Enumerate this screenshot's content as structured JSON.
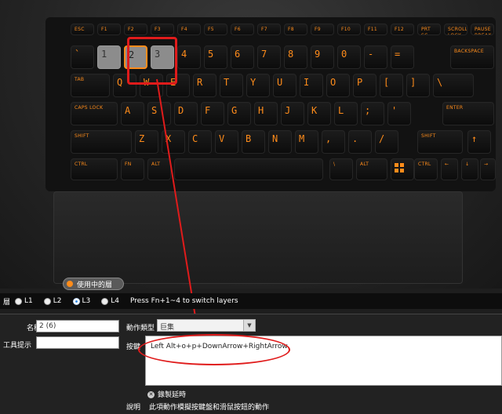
{
  "keyboard": {
    "row_fn": [
      "ESC",
      "F1",
      "F2",
      "F3",
      "F4",
      "F5",
      "F6",
      "F7",
      "F8",
      "F9",
      "F10",
      "F11",
      "F12",
      "PRT SC",
      "SCROLL LOCK",
      "PAUSE BREAK"
    ],
    "row_num": [
      "`",
      "1",
      "2",
      "3",
      "4",
      "5",
      "6",
      "7",
      "8",
      "9",
      "0",
      "-",
      "=",
      "BACKSPACE"
    ],
    "row_tab": [
      "TAB",
      "Q",
      "W",
      "E",
      "R",
      "T",
      "Y",
      "U",
      "I",
      "O",
      "P",
      "[",
      "]",
      "\\"
    ],
    "row_caps": [
      "CAPS LOCK",
      "A",
      "S",
      "D",
      "F",
      "G",
      "H",
      "J",
      "K",
      "L",
      ";",
      "'",
      "ENTER"
    ],
    "row_shift": [
      "SHIFT",
      "Z",
      "X",
      "C",
      "V",
      "B",
      "N",
      "M",
      ",",
      ".",
      "/",
      "SHIFT",
      "↑"
    ],
    "row_ctrl": [
      "CTRL",
      "FN",
      "ALT",
      "",
      "\\",
      "ALT",
      "",
      "CTRL",
      "←",
      "↓",
      "→"
    ]
  },
  "layer_badge": "使用中的層",
  "layer_bar": {
    "label": "層",
    "layers": [
      "L1",
      "L2",
      "L3",
      "L4"
    ],
    "selected": "L3",
    "hint": "Press Fn+1~4 to switch layers"
  },
  "form": {
    "name_label": "名稱",
    "name_value": "2 (6)",
    "tooltip_label": "工具提示",
    "tooltip_value": "",
    "action_type_label": "動作類型",
    "action_type_value": "巨集",
    "keys_label": "按鍵",
    "keys_value": "Left Alt+o+p+DownArrow+RightArrow",
    "record_delay_label": "錄製延時",
    "desc_label": "說明",
    "desc_text": "此項動作模擬按鍵盤和滑鼠按鈕的動作"
  },
  "colors": {
    "accent": "#ff8c1a",
    "highlight": "#e01b1b",
    "selected_radio": "#3a8de0"
  }
}
